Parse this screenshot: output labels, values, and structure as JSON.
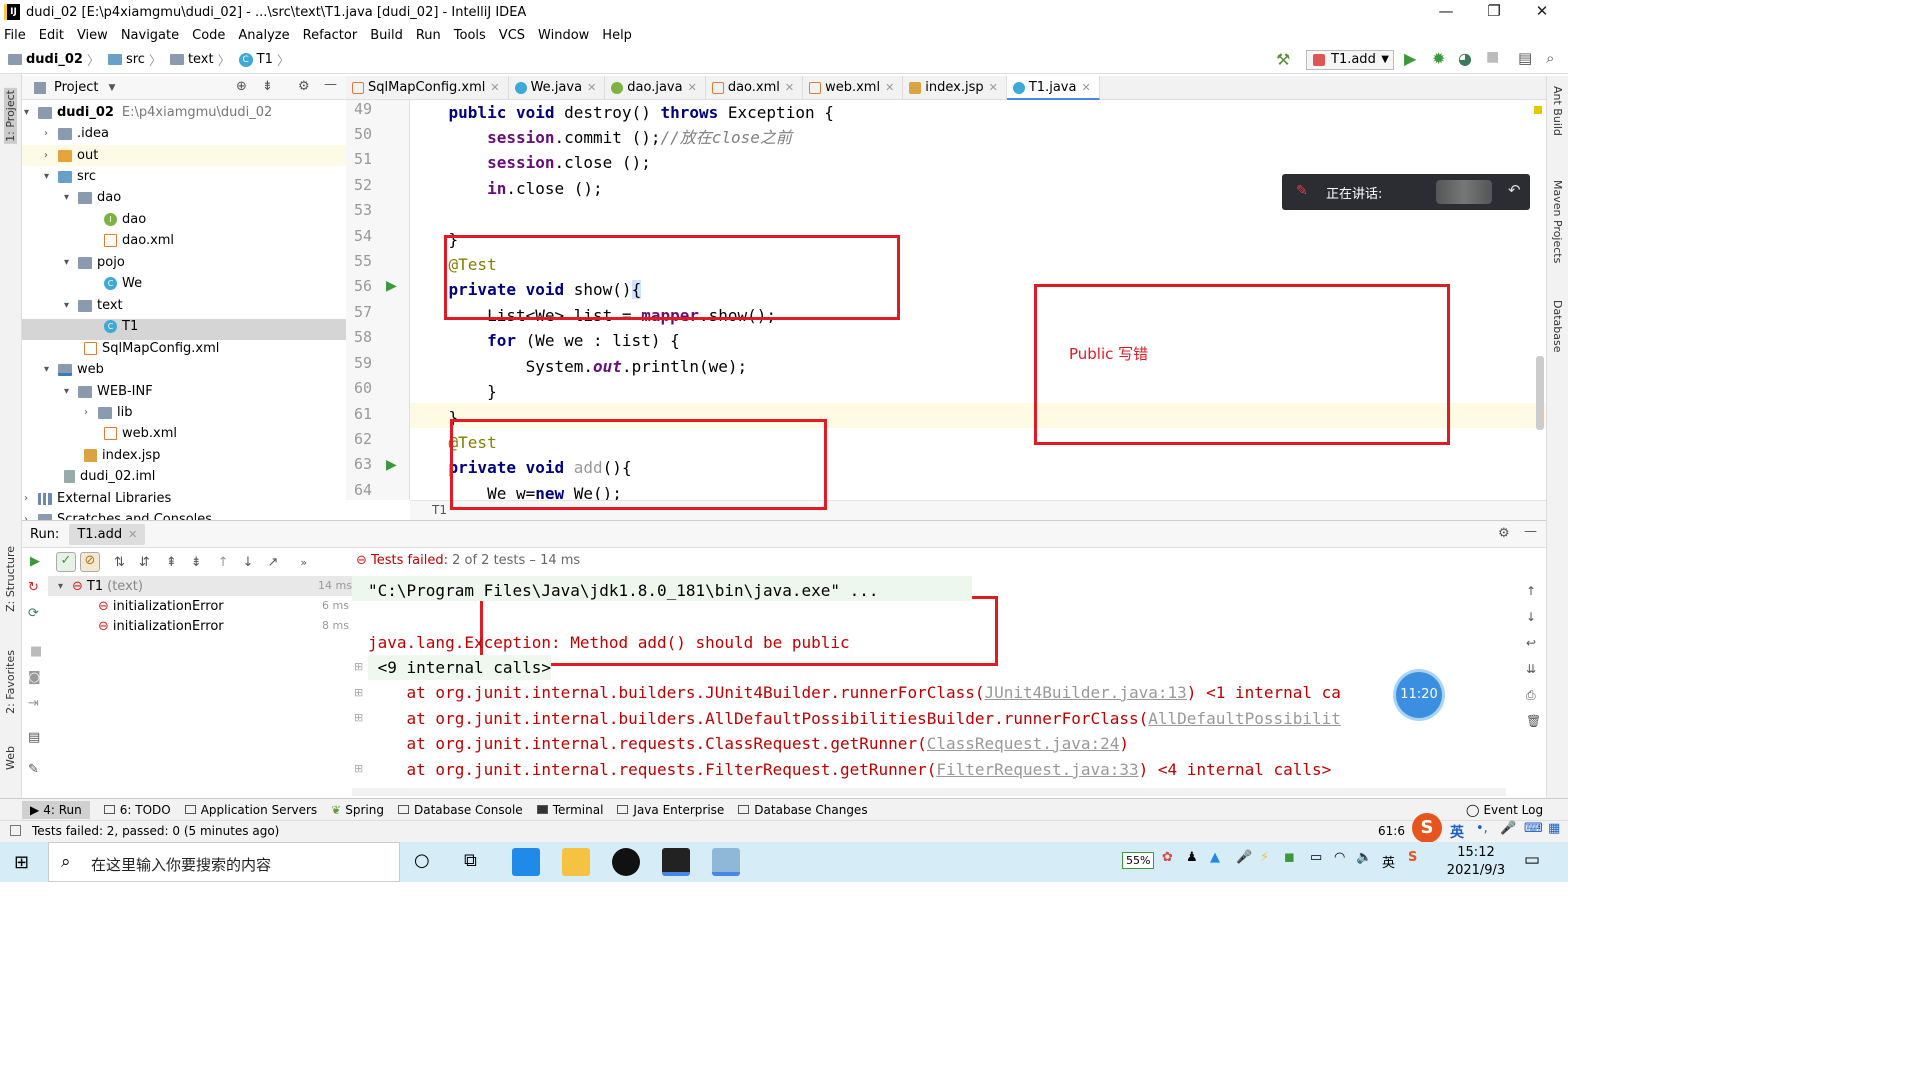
{
  "window": {
    "title": "dudi_02 [E:\\p4xiamgmu\\dudi_02] - ...\\src\\text\\T1.java [dudi_02] - IntelliJ IDEA",
    "app_icon": "IJ",
    "minimize": "—",
    "restore": "❐",
    "close": "✕"
  },
  "menu": [
    "File",
    "Edit",
    "View",
    "Navigate",
    "Code",
    "Analyze",
    "Refactor",
    "Build",
    "Run",
    "Tools",
    "VCS",
    "Window",
    "Help"
  ],
  "breadcrumb": {
    "project": "dudi_02",
    "src": "src",
    "text": "text",
    "file": "T1"
  },
  "run_config": {
    "label": "T1.add"
  },
  "left_stripe": {
    "project": "1: Project",
    "structure": "Z: Structure",
    "favorites": "2: Favorites",
    "web": "Web"
  },
  "right_stripe": {
    "ant": "Ant Build",
    "maven": "Maven Projects",
    "database": "Database"
  },
  "project_panel": {
    "title": "Project"
  },
  "tree": [
    {
      "label": "dudi_02",
      "extra": "E:\\p4xiamgmu\\dudi_02"
    },
    {
      "label": ".idea"
    },
    {
      "label": "out"
    },
    {
      "label": "src"
    },
    {
      "label": "dao"
    },
    {
      "label": "dao"
    },
    {
      "label": "dao.xml"
    },
    {
      "label": "pojo"
    },
    {
      "label": "We"
    },
    {
      "label": "text"
    },
    {
      "label": "T1"
    },
    {
      "label": "SqlMapConfig.xml"
    },
    {
      "label": "web"
    },
    {
      "label": "WEB-INF"
    },
    {
      "label": "lib"
    },
    {
      "label": "web.xml"
    },
    {
      "label": "index.jsp"
    },
    {
      "label": "dudi_02.iml"
    },
    {
      "label": "External Libraries"
    },
    {
      "label": "Scratches and Consoles"
    }
  ],
  "tabs": [
    "SqlMapConfig.xml",
    "We.java",
    "dao.java",
    "dao.xml",
    "web.xml",
    "index.jsp",
    "T1.java"
  ],
  "code": {
    "line_numbers": [
      "49",
      "50",
      "51",
      "52",
      "53",
      "54",
      "55",
      "56",
      "57",
      "58",
      "59",
      "60",
      "61",
      "62",
      "63",
      "64"
    ],
    "l49a": "    public void ",
    "l49b": "destroy() ",
    "l49c": "throws ",
    "l49d": "Exception {",
    "l50a": "        session",
    "l50b": ".commit ();",
    "l50c": "//放在close之前",
    "l51a": "        session",
    "l51b": ".close ();",
    "l52a": "        in",
    "l52b": ".close ();",
    "l54": "    }",
    "l55": "    @Test",
    "l56a": "    private void ",
    "l56b": "show()",
    "l57a": "        List<We> list = ",
    "l57b": "mapper",
    "l57c": ".show();",
    "l58a": "        for ",
    "l58b": "(We we : list) {",
    "l59a": "            System.",
    "l59b": "out",
    "l59c": ".println(we);",
    "l60": "        }",
    "l61": "    }",
    "l62": "    @Test",
    "l63a": "    private void ",
    "l63b": "add",
    "l63c": "(){",
    "l64a": "        We w=",
    "l64b": "new ",
    "l64c": "We();",
    "breadcrumb": "T1"
  },
  "annotation": {
    "note": "Public 写错"
  },
  "float_panel": {
    "label": "正在讲话:"
  },
  "run_panel": {
    "run_label": "Run:",
    "tab": "T1.add",
    "status_prefix": "Tests failed: ",
    "status_rest": "2 of 2 tests – 14 ms",
    "tree": [
      {
        "label": "T1",
        "extra": "(text)",
        "time": "14 ms"
      },
      {
        "label": "initializationError",
        "time": "6 ms"
      },
      {
        "label": "initializationError",
        "time": "8 ms"
      }
    ]
  },
  "console": {
    "l1": "\"C:\\Program Files\\Java\\jdk1.8.0_181\\bin\\java.exe\" ...",
    "l2": "java.lang.Exception: Method add() should be public",
    "l3": " <9 internal calls>",
    "l4a": "    at org.junit.internal.builders.JUnit4Builder.runnerForClass(",
    "l4b": "JUnit4Builder.java:13",
    "l4c": ") <1 internal ca",
    "l5a": "    at org.junit.internal.builders.AllDefaultPossibilitiesBuilder.runnerForClass(",
    "l5b": "AllDefaultPossibilit",
    "l6a": "    at org.junit.internal.requests.ClassRequest.getRunner(",
    "l6b": "ClassRequest.java:24",
    "l6c": ")",
    "l7a": "    at org.junit.internal.requests.FilterRequest.getRunner(",
    "l7b": "FilterRequest.java:33",
    "l7c": ") <4 internal calls>"
  },
  "time_bubble": "11:20",
  "tool_windows": [
    "4: Run",
    "6: TODO",
    "Application Servers",
    "Spring",
    "Database Console",
    "Terminal",
    "Java Enterprise",
    "Database Changes",
    "Event Log"
  ],
  "status": {
    "left": "Tests failed: 2, passed: 0 (5 minutes ago)",
    "position": "61:6",
    "ime": "英"
  },
  "taskbar": {
    "search_placeholder": "在这里输入你要搜索的内容",
    "time": "15:12",
    "date": "2021/9/3",
    "battery": "55%",
    "lang": "英"
  },
  "colors": {
    "accent": "#4a86e8",
    "error": "#c00000",
    "annotation_red": "#e01b24",
    "taskbar": "#d6ecf7"
  }
}
